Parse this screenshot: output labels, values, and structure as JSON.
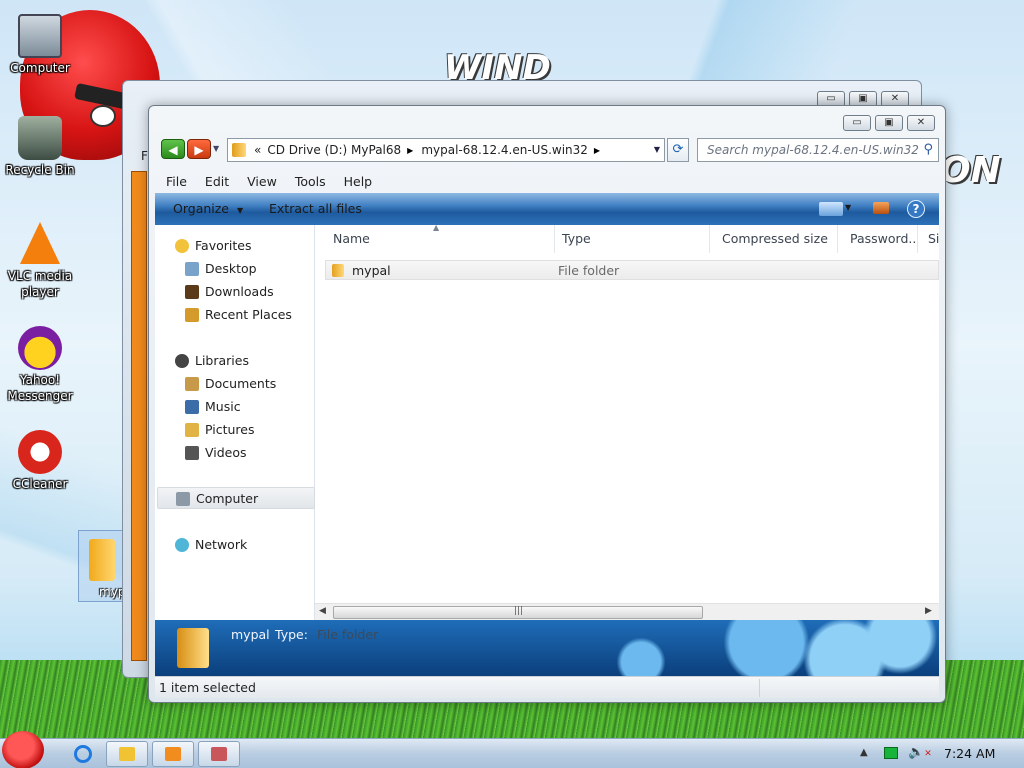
{
  "desktop": {
    "wallpaper_words": [
      "WIND",
      "ON"
    ],
    "icons": [
      {
        "label": "Computer"
      },
      {
        "label": "Recycle Bin"
      },
      {
        "label": "VLC media player"
      },
      {
        "label": "Yahoo! Messenger"
      },
      {
        "label": "CCleaner"
      },
      {
        "label": "myp"
      }
    ]
  },
  "back_window": {
    "menu_fragment": "F",
    "buttons": {
      "min": "▭",
      "max": "▣",
      "close": "✕"
    }
  },
  "window": {
    "buttons": {
      "min": "▭",
      "max": "▣",
      "close": "✕"
    },
    "nav": {
      "back": "◀",
      "forward": "▶",
      "dropdown": "▼"
    },
    "address": {
      "overflow": "«",
      "crumbs": [
        "CD Drive (D:) MyPal68",
        "mypal-68.12.4.en-US.win32"
      ],
      "separator": "▶",
      "dropdown": "▼"
    },
    "refresh_glyph": "⟳",
    "search_placeholder": "Search mypal-68.12.4.en-US.win32",
    "search_glyph": "⚲",
    "menu": [
      "File",
      "Edit",
      "View",
      "Tools",
      "Help"
    ],
    "toolbar": {
      "organize": "Organize",
      "organize_arrow": "▼",
      "extract": "Extract all files",
      "view_arrow": "▼",
      "help": "?"
    },
    "nav_pane": {
      "favorites": {
        "label": "Favorites",
        "items": [
          "Desktop",
          "Downloads",
          "Recent Places"
        ]
      },
      "libraries": {
        "label": "Libraries",
        "items": [
          "Documents",
          "Music",
          "Pictures",
          "Videos"
        ]
      },
      "computer": "Computer",
      "network": "Network"
    },
    "columns": [
      "Name",
      "Type",
      "Compressed size",
      "Password...",
      "Si"
    ],
    "sort_glyph": "▲",
    "rows": [
      {
        "name": "mypal",
        "type": "File folder"
      }
    ],
    "scroll": {
      "left": "◀",
      "right": "▶",
      "grip": "|||"
    },
    "details": {
      "name": "mypal",
      "type_label": "Type:",
      "type_value": "File folder"
    },
    "status": "1 item selected"
  },
  "taskbar": {
    "tray_up": "▲",
    "volume": "🔈",
    "volume_mute": "✕",
    "clock": "7:24 AM"
  },
  "colors": {
    "toolbar": "#2d72b9",
    "details_pane": "#1f6db8",
    "nav_back": "#2c8a1c",
    "nav_forward": "#c93a10"
  }
}
